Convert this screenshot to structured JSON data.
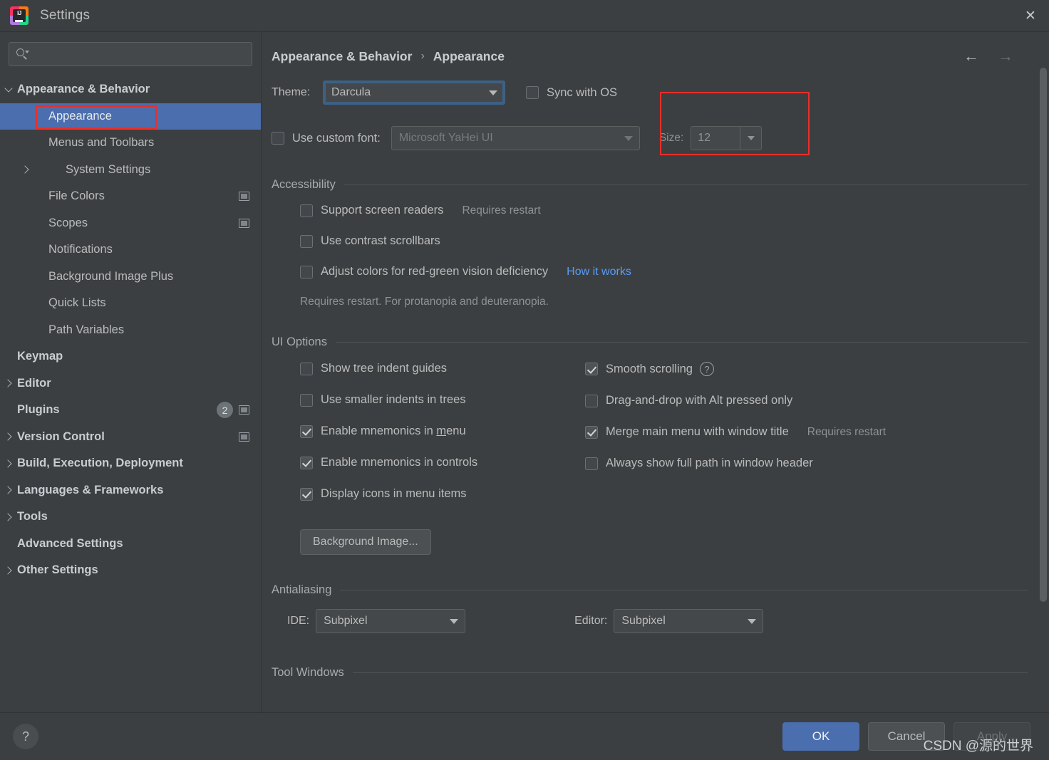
{
  "window": {
    "title": "Settings",
    "logo_text": "IJ",
    "close_icon": "✕"
  },
  "sidebar": {
    "search": {
      "value": "",
      "placeholder": ""
    },
    "items": [
      {
        "label": "Appearance & Behavior",
        "level": 0,
        "bold": true,
        "arrow": "expanded",
        "selected": false,
        "proj_icon": false,
        "badge": null
      },
      {
        "label": "Appearance",
        "level": 1,
        "bold": false,
        "arrow": "none",
        "selected": true,
        "proj_icon": false,
        "badge": null
      },
      {
        "label": "Menus and Toolbars",
        "level": 1,
        "bold": false,
        "arrow": "none",
        "selected": false,
        "proj_icon": false,
        "badge": null
      },
      {
        "label": "System Settings",
        "level": 1,
        "bold": false,
        "arrow": "collapsed",
        "selected": false,
        "proj_icon": false,
        "badge": null
      },
      {
        "label": "File Colors",
        "level": 1,
        "bold": false,
        "arrow": "none",
        "selected": false,
        "proj_icon": true,
        "badge": null
      },
      {
        "label": "Scopes",
        "level": 1,
        "bold": false,
        "arrow": "none",
        "selected": false,
        "proj_icon": true,
        "badge": null
      },
      {
        "label": "Notifications",
        "level": 1,
        "bold": false,
        "arrow": "none",
        "selected": false,
        "proj_icon": false,
        "badge": null
      },
      {
        "label": "Background Image Plus",
        "level": 1,
        "bold": false,
        "arrow": "none",
        "selected": false,
        "proj_icon": false,
        "badge": null
      },
      {
        "label": "Quick Lists",
        "level": 1,
        "bold": false,
        "arrow": "none",
        "selected": false,
        "proj_icon": false,
        "badge": null
      },
      {
        "label": "Path Variables",
        "level": 1,
        "bold": false,
        "arrow": "none",
        "selected": false,
        "proj_icon": false,
        "badge": null
      },
      {
        "label": "Keymap",
        "level": 0,
        "bold": true,
        "arrow": "none",
        "selected": false,
        "proj_icon": false,
        "badge": null
      },
      {
        "label": "Editor",
        "level": 0,
        "bold": true,
        "arrow": "collapsed",
        "selected": false,
        "proj_icon": false,
        "badge": null
      },
      {
        "label": "Plugins",
        "level": 0,
        "bold": true,
        "arrow": "none",
        "selected": false,
        "proj_icon": true,
        "badge": "2"
      },
      {
        "label": "Version Control",
        "level": 0,
        "bold": true,
        "arrow": "collapsed",
        "selected": false,
        "proj_icon": true,
        "badge": null
      },
      {
        "label": "Build, Execution, Deployment",
        "level": 0,
        "bold": true,
        "arrow": "collapsed",
        "selected": false,
        "proj_icon": false,
        "badge": null
      },
      {
        "label": "Languages & Frameworks",
        "level": 0,
        "bold": true,
        "arrow": "collapsed",
        "selected": false,
        "proj_icon": false,
        "badge": null
      },
      {
        "label": "Tools",
        "level": 0,
        "bold": true,
        "arrow": "collapsed",
        "selected": false,
        "proj_icon": false,
        "badge": null
      },
      {
        "label": "Advanced Settings",
        "level": 0,
        "bold": true,
        "arrow": "none",
        "selected": false,
        "proj_icon": false,
        "badge": null
      },
      {
        "label": "Other Settings",
        "level": 0,
        "bold": true,
        "arrow": "collapsed",
        "selected": false,
        "proj_icon": false,
        "badge": null
      }
    ]
  },
  "breadcrumb": {
    "parent": "Appearance & Behavior",
    "separator": "›",
    "current": "Appearance",
    "back_icon": "←",
    "forward_icon": "→"
  },
  "theme_row": {
    "theme_label": "Theme:",
    "theme_value": "Darcula",
    "sync_with_os_label": "Sync with OS",
    "sync_with_os_checked": false
  },
  "font_row": {
    "use_custom_font_label": "Use custom font:",
    "use_custom_font_checked": false,
    "font_value": "Microsoft YaHei UI",
    "size_label": "Size:",
    "size_value": "12"
  },
  "accessibility": {
    "title": "Accessibility",
    "items": [
      {
        "label": "Support screen readers",
        "checked": false,
        "note": "Requires restart",
        "link": null
      },
      {
        "label": "Use contrast scrollbars",
        "checked": false,
        "note": null,
        "link": null
      },
      {
        "label": "Adjust colors for red-green vision deficiency",
        "checked": false,
        "note": null,
        "link": "How it works"
      }
    ],
    "footnote": "Requires restart. For protanopia and deuteranopia."
  },
  "ui_options": {
    "title": "UI Options",
    "left_column": [
      {
        "label": "Show tree indent guides",
        "checked": false,
        "mnemonic": null
      },
      {
        "label": "Use smaller indents in trees",
        "checked": false,
        "mnemonic": null
      },
      {
        "label": "Enable mnemonics in menu",
        "checked": true,
        "mnemonic": "m"
      },
      {
        "label": "Enable mnemonics in controls",
        "checked": true,
        "mnemonic": null
      },
      {
        "label": "Display icons in menu items",
        "checked": true,
        "mnemonic": null
      }
    ],
    "right_column": [
      {
        "label": "Smooth scrolling",
        "checked": true,
        "help": true,
        "note": null
      },
      {
        "label": "Drag-and-drop with Alt pressed only",
        "checked": false,
        "help": false,
        "note": null
      },
      {
        "label": "Merge main menu with window title",
        "checked": true,
        "help": false,
        "note": "Requires restart"
      },
      {
        "label": "Always show full path in window header",
        "checked": false,
        "help": false,
        "note": null
      }
    ],
    "background_image_button": "Background Image..."
  },
  "antialiasing": {
    "title": "Antialiasing",
    "ide_label": "IDE:",
    "ide_value": "Subpixel",
    "editor_label": "Editor:",
    "editor_value": "Subpixel"
  },
  "tool_windows": {
    "title": "Tool Windows"
  },
  "footer": {
    "help_icon": "?",
    "ok_label": "OK",
    "cancel_label": "Cancel",
    "apply_label": "Apply",
    "watermark": "CSDN @源的世界"
  },
  "colors": {
    "background": "#3c3f41",
    "selection_blue": "#4b6eaf",
    "link_blue": "#589df6",
    "annotation_red": "#e8302a",
    "focus_border": "#3d6185"
  }
}
